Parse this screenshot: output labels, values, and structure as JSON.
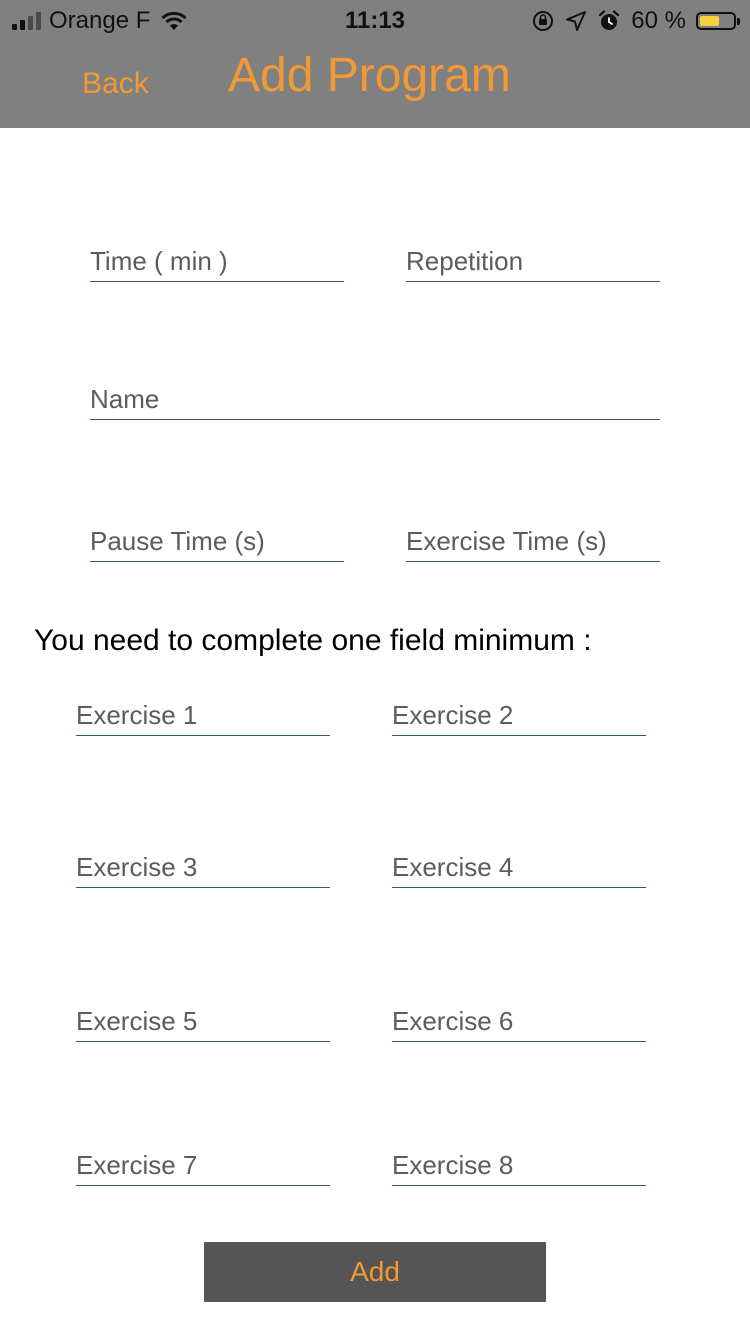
{
  "status_bar": {
    "carrier": "Orange F",
    "time": "11:13",
    "battery_percent": "60 %",
    "battery_level": 0.6,
    "signal_bars": 4,
    "signal_bars_filled": 2,
    "icons": [
      "signal-icon",
      "wifi-icon",
      "orientation-lock-icon",
      "location-icon",
      "alarm-icon",
      "battery-icon"
    ]
  },
  "header": {
    "back_label": "Back",
    "title": "Add Program"
  },
  "form": {
    "time_placeholder": "Time ( min )",
    "repetition_placeholder": "Repetition",
    "name_placeholder": "Name",
    "pause_time_placeholder": "Pause Time (s)",
    "exercise_time_placeholder": "Exercise Time (s)"
  },
  "notice": "You need to complete one field minimum :",
  "exercises": {
    "e1": "Exercise 1",
    "e2": "Exercise 2",
    "e3": "Exercise 3",
    "e4": "Exercise 4",
    "e5": "Exercise 5",
    "e6": "Exercise 6",
    "e7": "Exercise 7",
    "e8": "Exercise 8"
  },
  "add_button_label": "Add",
  "colors": {
    "accent": "#f19a33",
    "header_background": "#808080",
    "button_background": "#555555",
    "field_underline": "#2f5a66",
    "battery_fill": "#f5d33f"
  }
}
